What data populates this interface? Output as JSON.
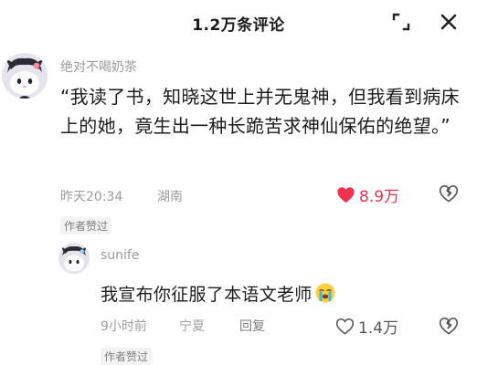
{
  "header": {
    "title": "1.2万条评论",
    "expand_icon": "expand-icon",
    "close_icon": "close-icon"
  },
  "comment": {
    "username": "绝对不喝奶茶",
    "text": "“我读了书，知晓这世上并无鬼神，但我看到病床上的她，竟生出一种长跪苦求神仙保佑的绝望。”",
    "time": "昨天20:34",
    "location": "湖南",
    "likes": "8.9万",
    "liked": true,
    "like_color": "#f0304f",
    "badge": "作者赞过"
  },
  "reply": {
    "username": "sunife",
    "text": "我宣布你征服了本语文老师",
    "emoji": "loudly-crying-face",
    "time": "9小时前",
    "location": "宁夏",
    "reply_label": "回复",
    "likes": "1.4万",
    "badge": "作者赞过"
  }
}
